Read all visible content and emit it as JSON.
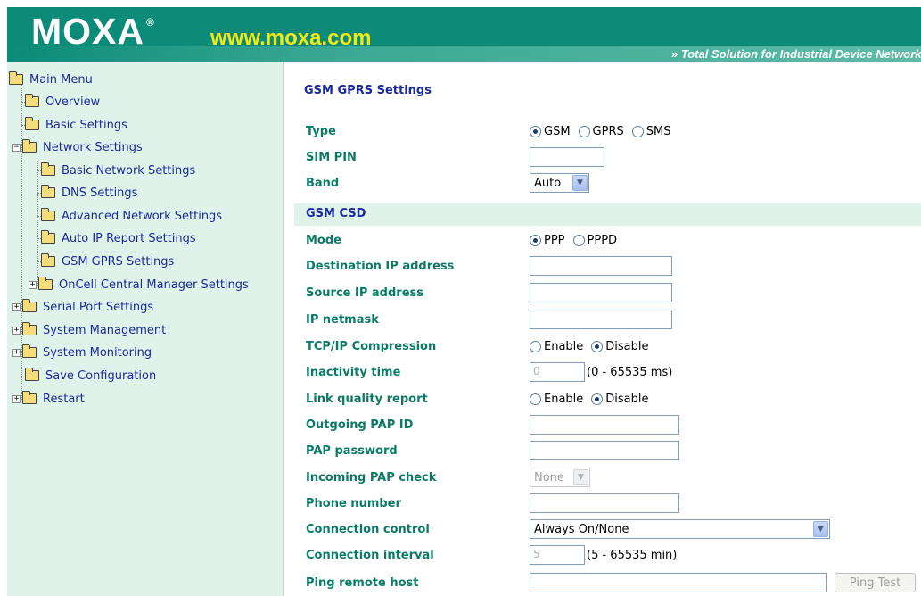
{
  "header": {
    "logo": "MOXA",
    "registered_mark": "®",
    "url": "www.moxa.com",
    "tagline": "» Total Solution for Industrial Device Networking"
  },
  "sidebar": {
    "items": [
      {
        "label": "Main Menu"
      },
      {
        "label": "Overview"
      },
      {
        "label": "Basic Settings"
      },
      {
        "label": "Network Settings"
      },
      {
        "label": "Basic Network Settings"
      },
      {
        "label": "DNS Settings"
      },
      {
        "label": "Advanced Network Settings"
      },
      {
        "label": "Auto IP Report Settings"
      },
      {
        "label": "GSM GPRS Settings"
      },
      {
        "label": "OnCell Central Manager Settings"
      },
      {
        "label": "Serial Port Settings"
      },
      {
        "label": "System Management"
      },
      {
        "label": "System Monitoring"
      },
      {
        "label": "Save Configuration"
      },
      {
        "label": "Restart"
      }
    ],
    "expander_collapsed": "+",
    "expander_expanded": "−"
  },
  "main": {
    "title": "GSM GPRS Settings",
    "type": {
      "label": "Type",
      "options": [
        "GSM",
        "GPRS",
        "SMS"
      ],
      "selected": "GSM"
    },
    "sim_pin": {
      "label": "SIM PIN",
      "value": ""
    },
    "band": {
      "label": "Band",
      "value": "Auto"
    },
    "section": "GSM CSD",
    "mode": {
      "label": "Mode",
      "options": [
        "PPP",
        "PPPD"
      ],
      "selected": "PPP"
    },
    "dest_ip": {
      "label": "Destination IP address",
      "value": ""
    },
    "source_ip": {
      "label": "Source IP address",
      "value": ""
    },
    "netmask": {
      "label": "IP netmask",
      "value": ""
    },
    "tcp_comp": {
      "label": "TCP/IP Compression",
      "options": [
        "Enable",
        "Disable"
      ],
      "selected": "Disable"
    },
    "inactivity": {
      "label": "Inactivity time",
      "value": "0",
      "hint": "(0 - 65535 ms)"
    },
    "link_quality": {
      "label": "Link quality report",
      "options": [
        "Enable",
        "Disable"
      ],
      "selected": "Disable"
    },
    "pap_id": {
      "label": "Outgoing PAP ID",
      "value": ""
    },
    "pap_password": {
      "label": "PAP password",
      "value": ""
    },
    "pap_check": {
      "label": "Incoming PAP check",
      "value": "None"
    },
    "phone": {
      "label": "Phone number",
      "value": ""
    },
    "conn_control": {
      "label": "Connection control",
      "value": "Always On/None"
    },
    "conn_interval": {
      "label": "Connection interval",
      "value": "5",
      "hint": "(5 - 65535 min)"
    },
    "ping_host": {
      "label": "Ping remote host",
      "value": "",
      "button": "Ping Test"
    }
  },
  "colors": {
    "header_green": "#0b8b78",
    "url_yellow": "#f2e817",
    "sidebar_bg": "#dff3ea",
    "label_green": "#0b7a66",
    "link_blue": "#1a2a9a"
  }
}
